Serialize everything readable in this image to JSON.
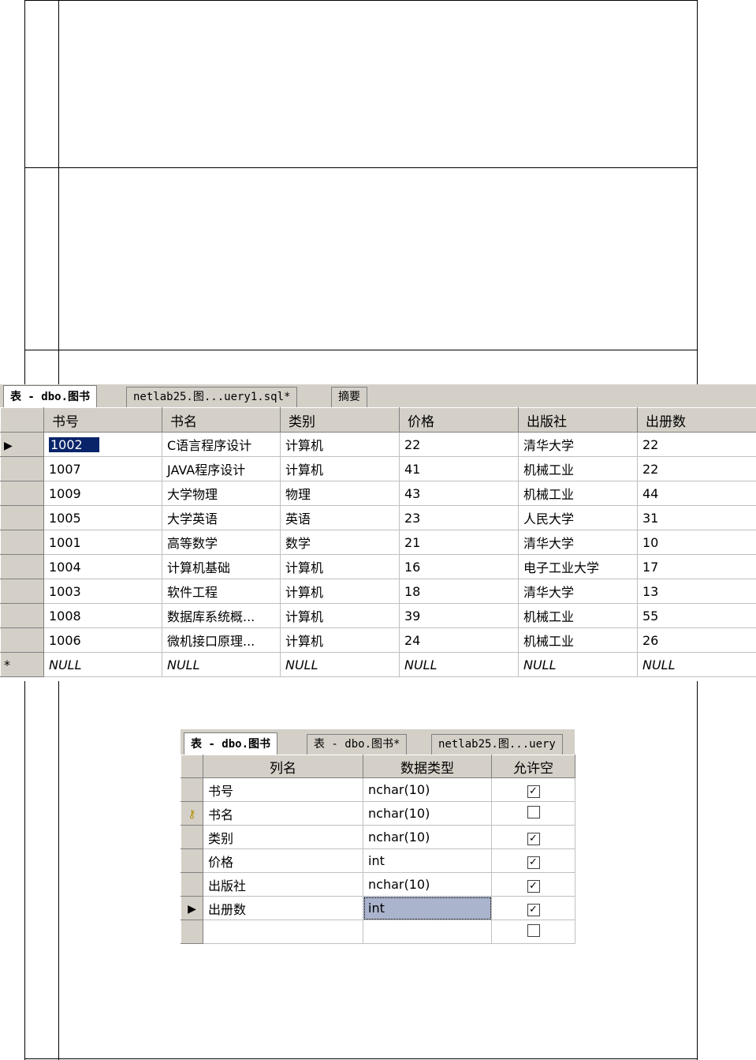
{
  "grid1": {
    "tabs": [
      "表 - dbo.图书",
      "netlab25.图...uery1.sql*",
      "摘要"
    ],
    "columns": [
      "书号",
      "书名",
      "类别",
      "价格",
      "出版社",
      "出册数"
    ],
    "rows": [
      [
        "1002",
        "C语言程序设计",
        "计算机",
        "22",
        "清华大学",
        "22"
      ],
      [
        "1007",
        "JAVA程序设计",
        "计算机",
        "41",
        "机械工业",
        "22"
      ],
      [
        "1009",
        "大学物理",
        "物理",
        "43",
        "机械工业",
        "44"
      ],
      [
        "1005",
        "大学英语",
        "英语",
        "23",
        "人民大学",
        "31"
      ],
      [
        "1001",
        "高等数学",
        "数学",
        "21",
        "清华大学",
        "10"
      ],
      [
        "1004",
        "计算机基础",
        "计算机",
        "16",
        "电子工业大学",
        "17"
      ],
      [
        "1003",
        "软件工程",
        "计算机",
        "18",
        "清华大学",
        "13"
      ],
      [
        "1008",
        "数据库系统概...",
        "计算机",
        "39",
        "机械工业",
        "55"
      ],
      [
        "1006",
        "微机接口原理...",
        "计算机",
        "24",
        "机械工业",
        "26"
      ]
    ],
    "new_row": [
      "NULL",
      "NULL",
      "NULL",
      "NULL",
      "NULL",
      "NULL"
    ],
    "current_row_marker": "▶",
    "new_row_marker": "*"
  },
  "grid2": {
    "tabs": [
      "表 - dbo.图书",
      "表 - dbo.图书*",
      "netlab25.图...uery"
    ],
    "columns": [
      "列名",
      "数据类型",
      "允许空"
    ],
    "rows": [
      {
        "name": "书号",
        "type": "nchar(10)",
        "nullable": true
      },
      {
        "name": "书名",
        "type": "nchar(10)",
        "nullable": false
      },
      {
        "name": "类别",
        "type": "nchar(10)",
        "nullable": true
      },
      {
        "name": "价格",
        "type": "int",
        "nullable": true
      },
      {
        "name": "出版社",
        "type": "nchar(10)",
        "nullable": true
      },
      {
        "name": "出册数",
        "type": "int",
        "nullable": true
      },
      {
        "name": "",
        "type": "",
        "nullable": false
      }
    ],
    "check_mark": "✓",
    "current_row_marker": "▶"
  }
}
